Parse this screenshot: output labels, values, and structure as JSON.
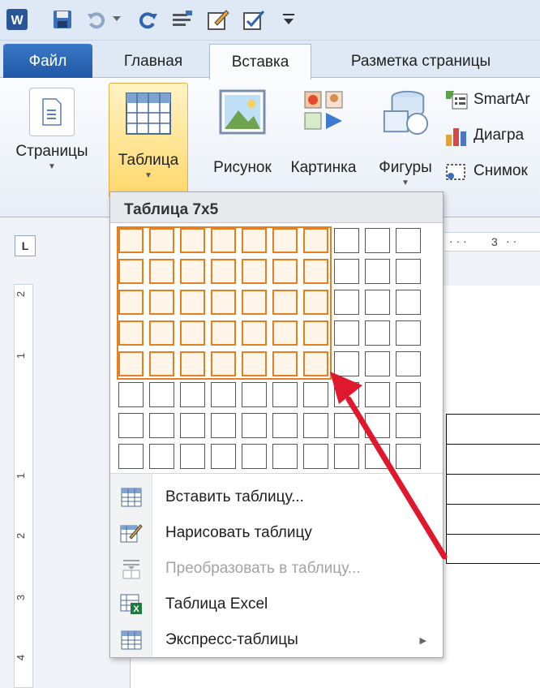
{
  "quick_access": {
    "icons": [
      "word-logo-icon",
      "save-icon",
      "undo-icon",
      "redo-icon",
      "format-icon",
      "edit-icon",
      "checklist-icon",
      "customize-icon"
    ]
  },
  "tabs": [
    {
      "label": "Файл"
    },
    {
      "label": "Главная"
    },
    {
      "label": "Вставка"
    },
    {
      "label": "Разметка страницы"
    }
  ],
  "ribbon": {
    "pages_label": "Страницы",
    "table_label": "Таблица",
    "picture_label": "Рисунок",
    "clipart_label": "Картинка",
    "shapes_label": "Фигуры",
    "smartart_label": "SmartAr",
    "chart_label": "Диагра",
    "screenshot_label": "Снимок"
  },
  "ruler": {
    "h_mark": "3",
    "v_marks": [
      "2",
      "1",
      "1",
      "2",
      "3",
      "4"
    ]
  },
  "dropdown": {
    "title": "Таблица 7x5",
    "grid": {
      "cols": 10,
      "rows": 8,
      "selected_cols": 7,
      "selected_rows": 5
    },
    "items": [
      {
        "label": "Вставить таблицу...",
        "icon": "insert-table-icon",
        "enabled": true
      },
      {
        "label": "Нарисовать таблицу",
        "icon": "draw-table-icon",
        "enabled": true
      },
      {
        "label": "Преобразовать в таблицу...",
        "icon": "convert-table-icon",
        "enabled": false
      },
      {
        "label": "Таблица Excel",
        "icon": "excel-table-icon",
        "enabled": true
      },
      {
        "label": "Экспресс-таблицы",
        "icon": "quick-tables-icon",
        "enabled": true,
        "submenu": true
      }
    ]
  },
  "colors": {
    "highlight": "#e67e22",
    "arrow": "#e0182d",
    "file_tab": "#2a64b3"
  }
}
